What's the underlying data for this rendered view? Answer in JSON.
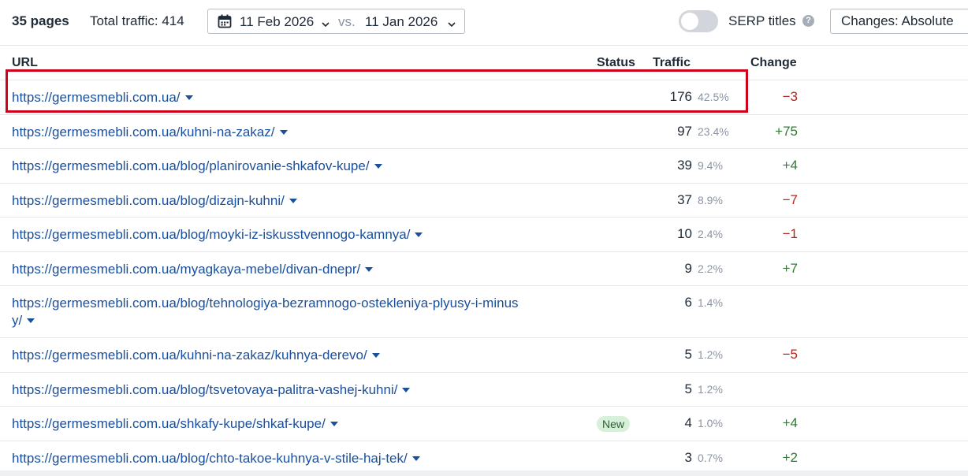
{
  "summary": {
    "pages_count": "35 pages",
    "total_traffic": "Total traffic: 414"
  },
  "date_range": {
    "current": "11 Feb 2026",
    "vs": "vs.",
    "previous": "11 Jan 2026"
  },
  "serp_toggle": {
    "label": "SERP titles",
    "enabled": false
  },
  "changes_select": {
    "label": "Changes: Absolute"
  },
  "table": {
    "columns": {
      "url": "URL",
      "status": "Status",
      "traffic": "Traffic",
      "change": "Change"
    },
    "rows": [
      {
        "url": "https://germesmebli.com.ua/",
        "status": "",
        "traffic": "176",
        "pct": "42.5%",
        "change": "−3",
        "dir": "neg"
      },
      {
        "url": "https://germesmebli.com.ua/kuhni-na-zakaz/",
        "status": "",
        "traffic": "97",
        "pct": "23.4%",
        "change": "+75",
        "dir": "pos"
      },
      {
        "url": "https://germesmebli.com.ua/blog/planirovanie-shkafov-kupe/",
        "status": "",
        "traffic": "39",
        "pct": "9.4%",
        "change": "+4",
        "dir": "pos"
      },
      {
        "url": "https://germesmebli.com.ua/blog/dizajn-kuhni/",
        "status": "",
        "traffic": "37",
        "pct": "8.9%",
        "change": "−7",
        "dir": "neg"
      },
      {
        "url": "https://germesmebli.com.ua/blog/moyki-iz-iskusstvennogo-kamnya/",
        "status": "",
        "traffic": "10",
        "pct": "2.4%",
        "change": "−1",
        "dir": "neg"
      },
      {
        "url": "https://germesmebli.com.ua/myagkaya-mebel/divan-dnepr/",
        "status": "",
        "traffic": "9",
        "pct": "2.2%",
        "change": "+7",
        "dir": "pos"
      },
      {
        "url": "https://germesmebli.com.ua/blog/tehnologiya-bezramnogo-ostekleniya-plyusy-i-minus",
        "url_line2": "y/",
        "status": "",
        "traffic": "6",
        "pct": "1.4%",
        "change": "",
        "dir": ""
      },
      {
        "url": "https://germesmebli.com.ua/kuhni-na-zakaz/kuhnya-derevo/",
        "status": "",
        "traffic": "5",
        "pct": "1.2%",
        "change": "−5",
        "dir": "neg"
      },
      {
        "url": "https://germesmebli.com.ua/blog/tsvetovaya-palitra-vashej-kuhni/",
        "status": "",
        "traffic": "5",
        "pct": "1.2%",
        "change": "",
        "dir": ""
      },
      {
        "url": "https://germesmebli.com.ua/shkafy-kupe/shkaf-kupe/",
        "status": "New",
        "traffic": "4",
        "pct": "1.0%",
        "change": "+4",
        "dir": "pos"
      },
      {
        "url": "https://germesmebli.com.ua/blog/chto-takoe-kuhnya-v-stile-haj-tek/",
        "status": "",
        "traffic": "3",
        "pct": "0.7%",
        "change": "+2",
        "dir": "pos"
      }
    ]
  },
  "colors": {
    "link": "#1a4f9c",
    "negative": "#b3261e",
    "positive": "#2e7d32",
    "highlight": "#d0021b"
  }
}
